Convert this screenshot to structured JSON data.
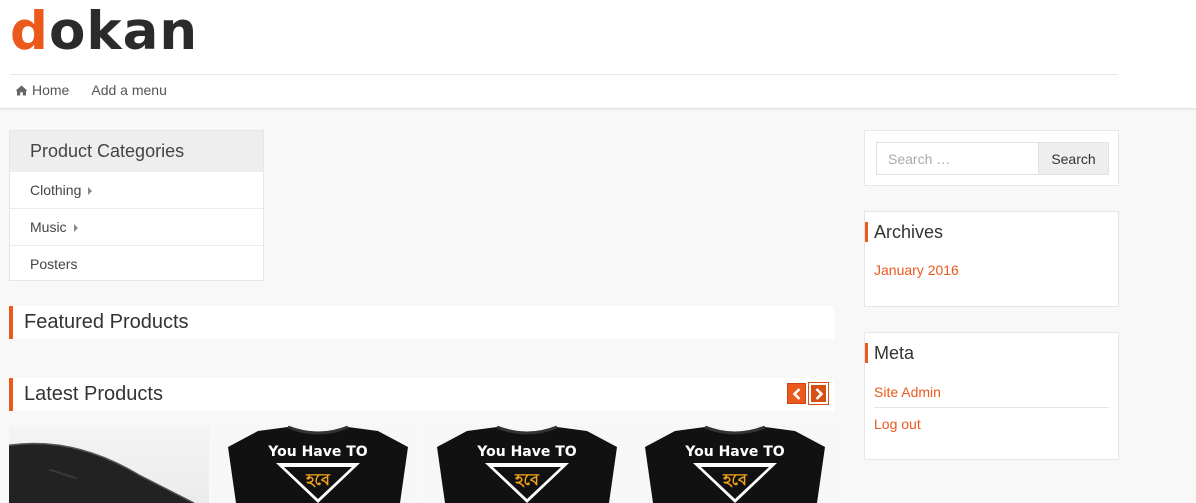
{
  "brand": {
    "logo_first": "d",
    "logo_rest": "okan",
    "accent": "#eb5a1c"
  },
  "nav": {
    "items": [
      {
        "label": "Home",
        "icon": "home-icon"
      },
      {
        "label": "Add a menu"
      }
    ]
  },
  "categories": {
    "title": "Product Categories",
    "items": [
      {
        "label": "Clothing",
        "has_children": true
      },
      {
        "label": "Music",
        "has_children": true
      },
      {
        "label": "Posters",
        "has_children": false
      }
    ]
  },
  "sections": {
    "featured": "Featured Products",
    "latest": "Latest Products"
  },
  "products": {
    "tshirt_text_top": "You Have TO",
    "tshirt_text_bengali": "হবে"
  },
  "sidebar": {
    "search": {
      "placeholder": "Search …",
      "button": "Search"
    },
    "archives": {
      "title": "Archives",
      "links": [
        "January 2016"
      ]
    },
    "meta": {
      "title": "Meta",
      "links": [
        "Site Admin",
        "Log out"
      ]
    }
  }
}
